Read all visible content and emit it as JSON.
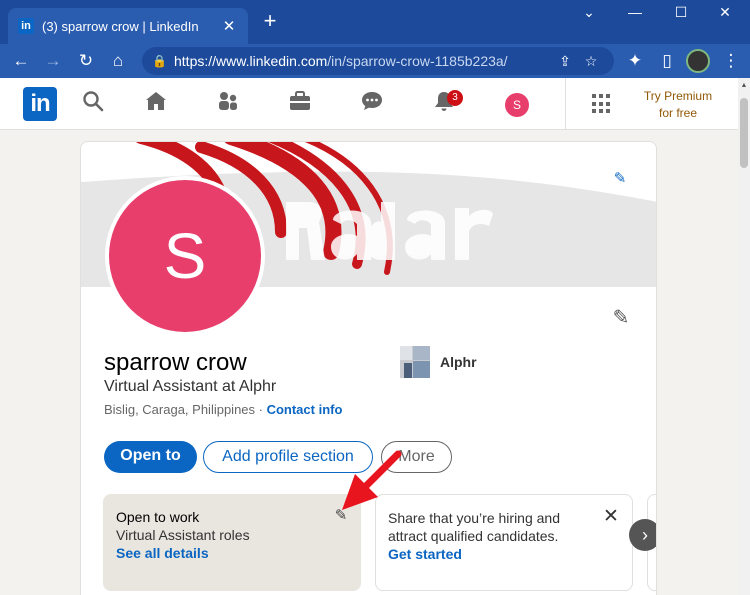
{
  "browser": {
    "tab_title": "(3) sparrow crow | LinkedIn",
    "favicon": "in",
    "url_host": "https://www.linkedin.com",
    "url_path": "/in/sparrow-crow-1185b223a/"
  },
  "nav": {
    "logo": "in",
    "notifications_count": "3",
    "avatar_initial": "S",
    "premium_line1": "Try Premium",
    "premium_line2": "for free"
  },
  "profile": {
    "avatar_initial": "S",
    "name": "sparrow crow",
    "headline": "Virtual Assistant at Alphr",
    "location": "Bislig, Caraga, Philippines · ",
    "contact_info": "Contact info",
    "company": "Alphr"
  },
  "actions": {
    "open_to": "Open to",
    "add_section": "Add profile section",
    "more": "More"
  },
  "open_to_work": {
    "title": "Open to work",
    "roles": "Virtual Assistant roles",
    "see_details": "See all details"
  },
  "hiring": {
    "text_line1": "Share that you’re hiring and",
    "text_line2": "attract qualified candidates.",
    "cta": "Get started"
  },
  "colors": {
    "linkedin_blue": "#0a66c2",
    "avatar_pink": "#e83e6c",
    "chrome_blue": "#2a5db0",
    "premium_gold": "#915907",
    "annotation_red": "#e8141e"
  },
  "icons": {
    "search": "search-icon",
    "home": "home-icon",
    "network": "network-icon",
    "jobs": "briefcase-icon",
    "messaging": "messaging-icon",
    "notifications": "bell-icon"
  }
}
